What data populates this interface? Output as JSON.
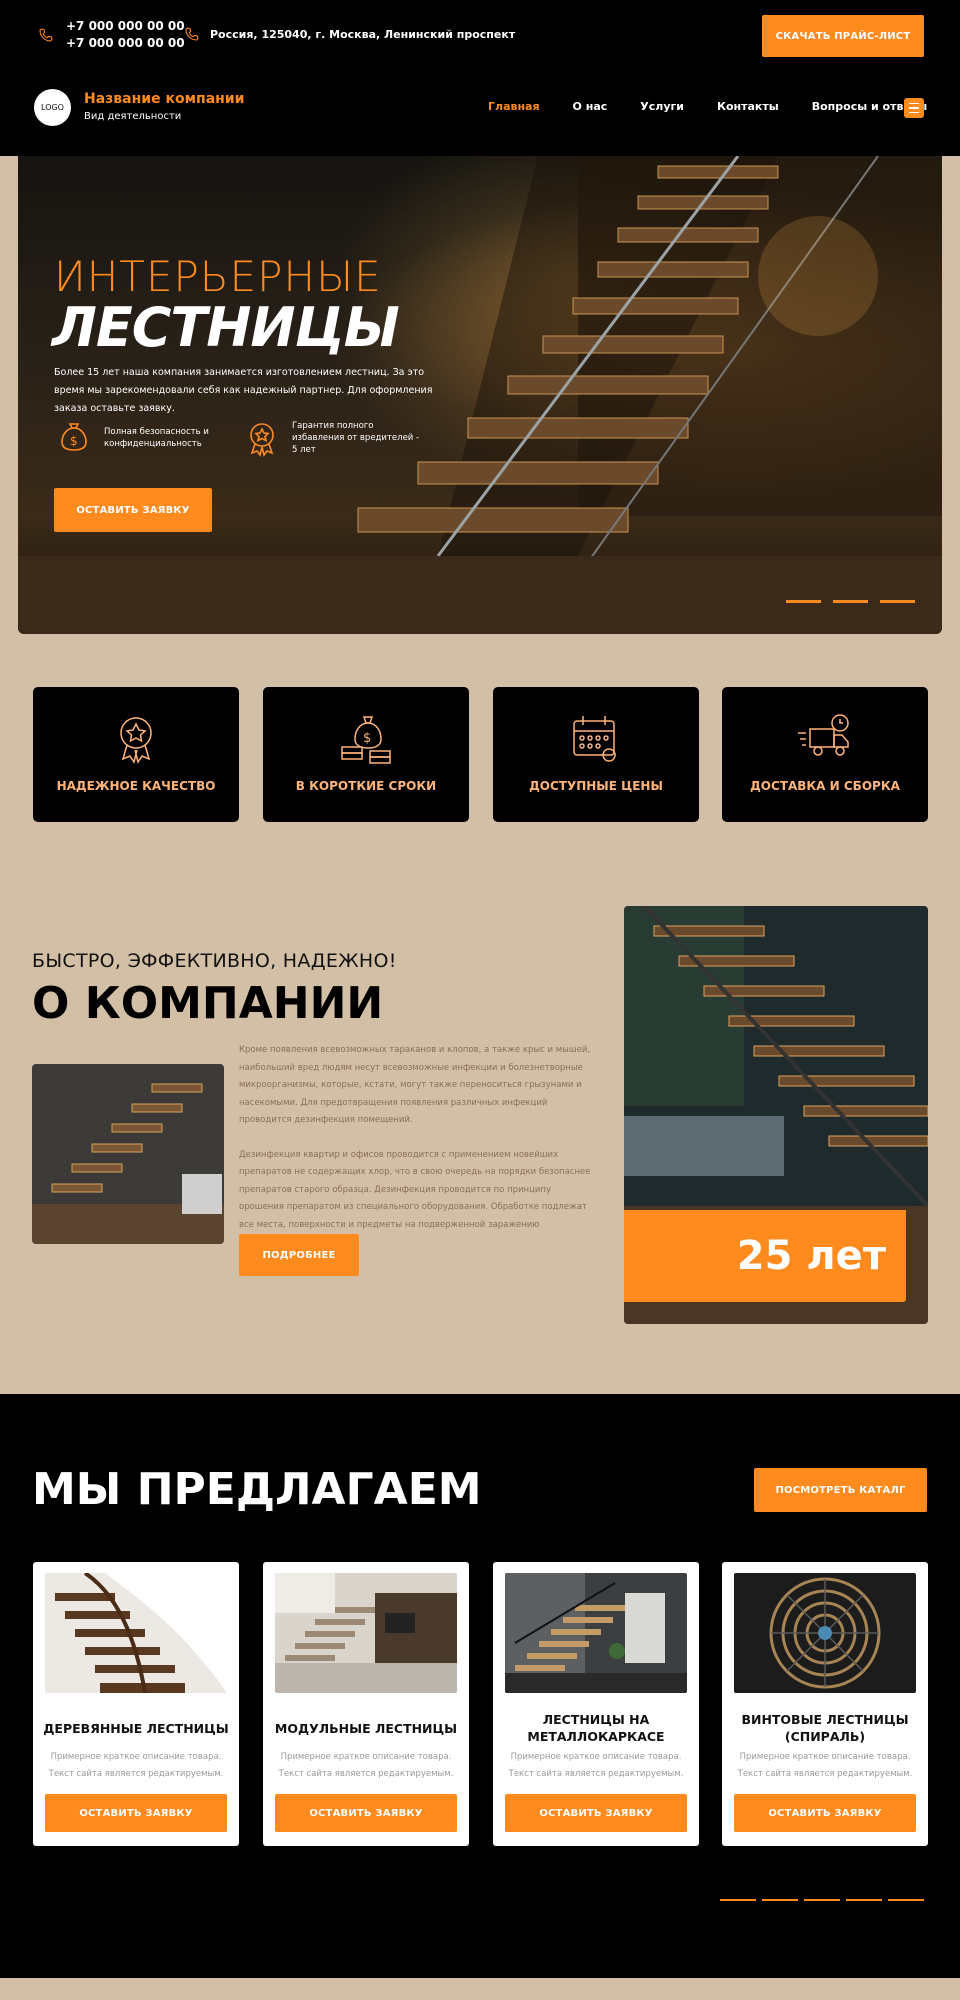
{
  "header": {
    "phone1": "+7 000 000 00 00",
    "phone2": "+7 000 000 00 00",
    "address": "Россия, 125040, г. Москва, Ленинский проспект",
    "price_button": "СКАЧАТЬ ПРАЙС-ЛИСТ",
    "logo": "LOGO",
    "company_name": "Название компании",
    "company_sub": "Вид деятельности",
    "nav": [
      "Главная",
      "О нас",
      "Услуги",
      "Контакты",
      "Вопросы и ответы"
    ],
    "icons": {
      "phone": "phone-icon",
      "location": "location-pin-icon",
      "menu": "hamburger-menu-icon"
    }
  },
  "hero": {
    "title1": "ИНТЕРЬЕРНЫЕ",
    "title2": "ЛЕСТНИЦЫ",
    "description": "Более 15 лет наша компания занимается изготовлением лестниц. За это время мы зарекомендовали себя как надежный партнер. Для оформления заказа оставьте заявку.",
    "feature1": "Полная безопасность и конфиденциальность",
    "feature2": "Гарантия полного избавления от вредителей - 5 лет",
    "button": "ОСТАВИТЬ ЗАЯВКУ",
    "slides": 3
  },
  "advantages": [
    {
      "label": "НАДЕЖНОЕ КАЧЕСТВО",
      "icon": "quality-badge-icon"
    },
    {
      "label": "В КОРОТКИЕ СРОКИ",
      "icon": "money-bag-icon"
    },
    {
      "label": "ДОСТУПНЫЕ ЦЕНЫ",
      "icon": "calendar-icon"
    },
    {
      "label": "ДОСТАВКА И СБОРКА",
      "icon": "delivery-truck-icon"
    }
  ],
  "about": {
    "pretitle": "БЫСТРО, ЭФФЕКТИВНО, НАДЕЖНО!",
    "title": "О КОМПАНИИ",
    "paragraph1": "Кроме появления всевозможных тараканов и клопов, а также крыс и мышей, наибольший вред людям несут всевозможные инфекции и болезнетворные микроорганизмы, которые, кстати, могут также переноситься грызунами и насекомыми. Для предотвращения появления различных инфекций проводится дезинфекция помещений.",
    "paragraph2": "Дезинфекция квартир и офисов проводится с применением новейших препаратов не содержащих хлор, что в свою очередь на порядки безопаснее препаратов старого образца. Дезинфекция проводится по принципу орошения препаратом из специального оборудования. Обработке подлежат все места, поверхности и предметы на подверженной заражению территории.",
    "button": "ПОДРОБНЕЕ",
    "years": "25 лет"
  },
  "offers": {
    "title": "МЫ ПРЕДЛАГАЕМ",
    "catalog_button": "ПОСМОТРЕТЬ КАТАЛГ",
    "cards": [
      {
        "name": "ДЕРЕВЯННЫЕ ЛЕСТНИЦЫ",
        "desc": "Примерное краткое описание товара. Текст сайта является редактируемым.",
        "button": "ОСТАВИТЬ ЗАЯВКУ"
      },
      {
        "name": "МОДУЛЬНЫЕ ЛЕСТНИЦЫ",
        "desc": "Примерное краткое описание товара. Текст сайта является редактируемым.",
        "button": "ОСТАВИТЬ ЗАЯВКУ"
      },
      {
        "name": "ЛЕСТНИЦЫ НА МЕТАЛЛОКАРКАСЕ",
        "desc": "Примерное краткое описание товара. Текст сайта является редактируемым.",
        "button": "ОСТАВИТЬ ЗАЯВКУ"
      },
      {
        "name": "ВИНТОВЫЕ ЛЕСТНИЦЫ (СПИРАЛЬ)",
        "desc": "Примерное краткое описание товара. Текст сайта является редактируемым.",
        "button": "ОСТАВИТЬ ЗАЯВКУ"
      }
    ],
    "slides": 5
  },
  "colors": {
    "accent": "#ff8a1e",
    "beige": "#d3bfa6",
    "dark": "#000000"
  }
}
